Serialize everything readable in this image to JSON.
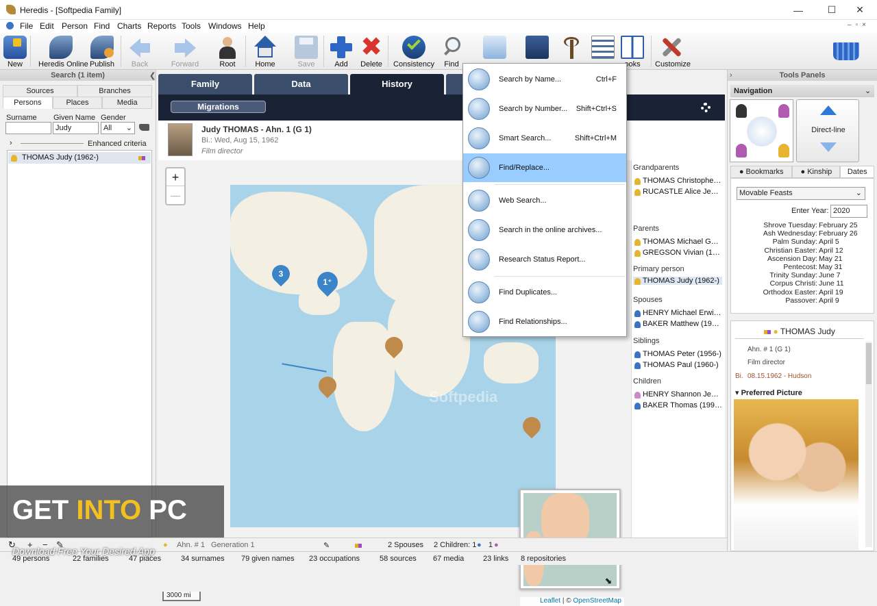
{
  "window": {
    "title": "Heredis - [Softpedia Family]",
    "minimize": "—",
    "maximize": "☐",
    "close": "✕"
  },
  "menu": [
    "File",
    "Edit",
    "Person",
    "Find",
    "Charts",
    "Reports",
    "Tools",
    "Windows",
    "Help"
  ],
  "toolbar": {
    "new": "New",
    "heredis_online": "Heredis Online",
    "publish": "Publish",
    "back": "Back",
    "forward": "Forward",
    "root": "Root",
    "home": "Home",
    "save": "Save",
    "add": "Add",
    "delete": "Delete",
    "consistency": "Consistency",
    "find": "Find",
    "books": "ooks",
    "customize": "Customize"
  },
  "left": {
    "header": "Search (1 item)",
    "tabs_top": [
      "Sources",
      "Branches"
    ],
    "tabs_bottom": [
      "Persons",
      "Places",
      "Media"
    ],
    "surname_label": "Surname",
    "given_label": "Given Name",
    "gender_label": "Gender",
    "surname_value": "",
    "given_value": "Judy",
    "gender_value": "All",
    "enhanced": "Enhanced criteria",
    "result": "THOMAS Judy (1962-)"
  },
  "center": {
    "tabs": [
      "Family",
      "Data",
      "History"
    ],
    "migrations": "Migrations",
    "person_name": "Judy THOMAS - Ahn. 1 (G 1)",
    "person_birth": "Bi.: Wed, Aug 15, 1962",
    "person_occupation": "Film director",
    "zoom_in": "+",
    "zoom_out": "—",
    "scale": "3000 mi",
    "attribution_leaflet": "Leaflet",
    "attribution_sep": " | © ",
    "attribution_osm": "OpenStreetMap",
    "cluster_3": "3",
    "cluster_1": "1⁺"
  },
  "relatives": {
    "grandparents_label": "Grandparents",
    "grandparents": [
      "THOMAS Christopher ...",
      "RUCASTLE Alice Jean (..."
    ],
    "parents_label": "Parents",
    "parents": [
      "THOMAS Michael Geor...",
      "GREGSON Vivian (1932-)"
    ],
    "primary_label": "Primary person",
    "primary": "THOMAS Judy (1962-)",
    "spouses_label": "Spouses",
    "spouses": [
      "HENRY Michael Erwin (...",
      "BAKER Matthew (1948-)"
    ],
    "siblings_label": "Siblings",
    "siblings": [
      "THOMAS Peter (1956-)",
      "THOMAS Paul (1960-)"
    ],
    "children_label": "Children",
    "children": [
      "HENRY Shannon Jean ...",
      "BAKER Thomas (1992-)"
    ]
  },
  "find_menu": [
    {
      "label": "Search by Name...",
      "shortcut": "Ctrl+F"
    },
    {
      "label": "Search by Number...",
      "shortcut": "Shift+Ctrl+S"
    },
    {
      "label": "Smart Search...",
      "shortcut": "Shift+Ctrl+M"
    },
    {
      "label": "Find/Replace...",
      "shortcut": ""
    },
    {
      "label": "Web Search...",
      "shortcut": ""
    },
    {
      "label": "Search in the online archives...",
      "shortcut": ""
    },
    {
      "label": "Research Status Report...",
      "shortcut": ""
    },
    {
      "label": "Find Duplicates...",
      "shortcut": ""
    },
    {
      "label": "Find Relationships...",
      "shortcut": ""
    }
  ],
  "right": {
    "header": "Tools Panels",
    "navigation": "Navigation",
    "direct_line": "Direct-line",
    "tabs": [
      "Bookmarks",
      "Kinship",
      "Dates"
    ],
    "feasts_select": "Movable Feasts",
    "enter_year_label": "Enter Year:",
    "year": "2020",
    "feasts": [
      [
        "Shrove Tuesday:",
        "February 25"
      ],
      [
        "Ash Wednesday:",
        "February 26"
      ],
      [
        "Palm Sunday:",
        "April 5"
      ],
      [
        "Christian Easter:",
        "April 12"
      ],
      [
        "Ascension Day:",
        "May 21"
      ],
      [
        "Pentecost:",
        "May 31"
      ],
      [
        "Trinity Sunday:",
        "June 7"
      ],
      [
        "Corpus Christi:",
        "June 11"
      ],
      [
        "Orthodox Easter:",
        "April 19"
      ],
      [
        "Passover:",
        "April 9"
      ]
    ],
    "card_name": "THOMAS Judy",
    "card_ahn": "Ahn. # 1 (G 1)",
    "card_occ": "Film director",
    "card_birth_label": "Bi.",
    "card_birth": "08.15.1962 - Hudson",
    "preferred_picture": "Preferred Picture"
  },
  "status1": {
    "ahn": "Ahn. # 1",
    "generation": "Generation 1",
    "spouses": "2 Spouses",
    "children": "2 Children: 1",
    "children_f": "1"
  },
  "status2": [
    "49 persons",
    "22 families",
    "47 places",
    "34 surnames",
    "79 given names",
    "23 occupations",
    "58 sources",
    "67 media",
    "23 links",
    "8 repositories"
  ],
  "watermark": {
    "get": "GET ",
    "into": "INTO",
    "pc": " PC",
    "tagline": "Download Free Your Desired App"
  },
  "map_watermark": "Softpedia"
}
